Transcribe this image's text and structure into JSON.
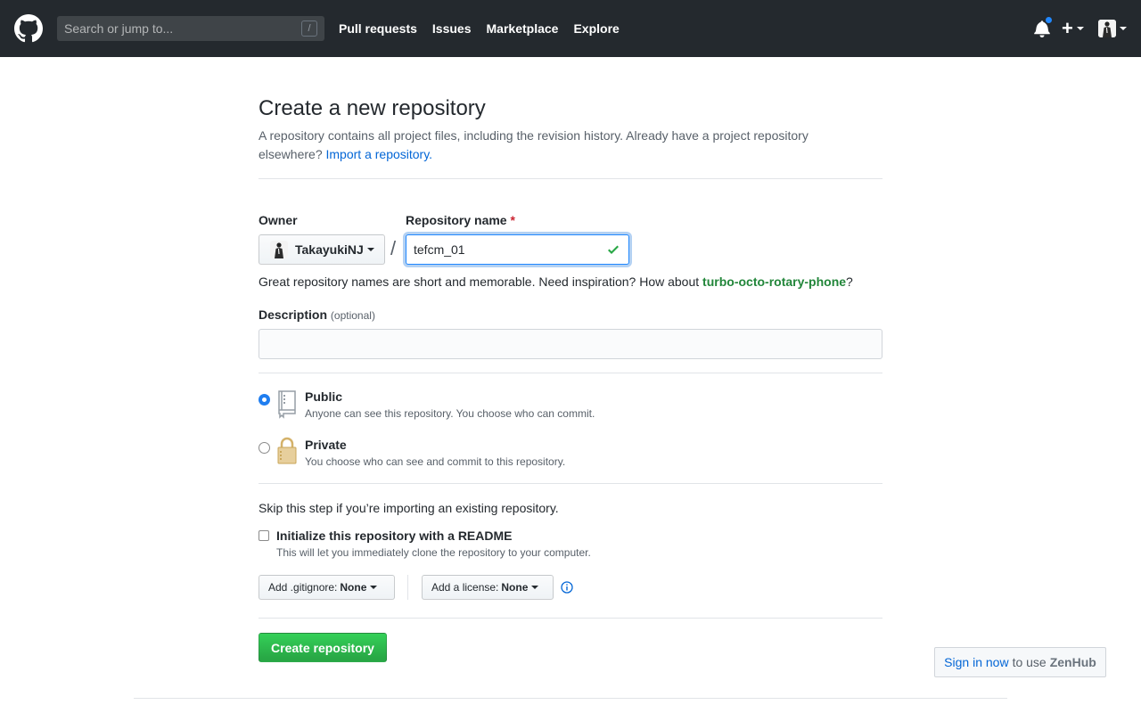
{
  "header": {
    "search_placeholder": "Search or jump to...",
    "search_shortcut": "/",
    "nav": [
      {
        "label": "Pull requests"
      },
      {
        "label": "Issues"
      },
      {
        "label": "Marketplace"
      },
      {
        "label": "Explore"
      }
    ],
    "plus_label": "+"
  },
  "page": {
    "title": "Create a new repository",
    "description": "A repository contains all project files, including the revision history. Already have a project repository elsewhere? ",
    "import_link": "Import a repository."
  },
  "form": {
    "owner_label": "Owner",
    "owner_name": "TakayukiNJ",
    "separator": "/",
    "repo_label": "Repository name",
    "required_mark": "*",
    "repo_value": "tefcm_01",
    "name_note_prefix": "Great repository names are short and memorable. Need inspiration? How about ",
    "name_suggestion": "turbo-octo-rotary-phone",
    "name_note_suffix": "?",
    "description_label": "Description",
    "description_optional": "(optional)",
    "description_value": ""
  },
  "visibility": {
    "options": [
      {
        "title": "Public",
        "note": "Anyone can see this repository. You choose who can commit.",
        "selected": true
      },
      {
        "title": "Private",
        "note": "You choose who can see and commit to this repository.",
        "selected": false
      }
    ]
  },
  "init": {
    "skip_text": "Skip this step if you’re importing an existing repository.",
    "readme_label": "Initialize this repository with a README",
    "readme_note": "This will let you immediately clone the repository to your computer.",
    "readme_checked": false,
    "gitignore_label": "Add .gitignore:",
    "gitignore_value": "None",
    "license_label": "Add a license:",
    "license_value": "None"
  },
  "submit_label": "Create repository",
  "zenhub": {
    "link": "Sign in now",
    "middle": "to use",
    "brand": "ZenHub"
  },
  "colors": {
    "header_bg": "#24292e",
    "link": "#0366d6",
    "primary_green": "#28a745",
    "suggestion_green": "#22863a",
    "notification_dot": "#2188ff"
  }
}
